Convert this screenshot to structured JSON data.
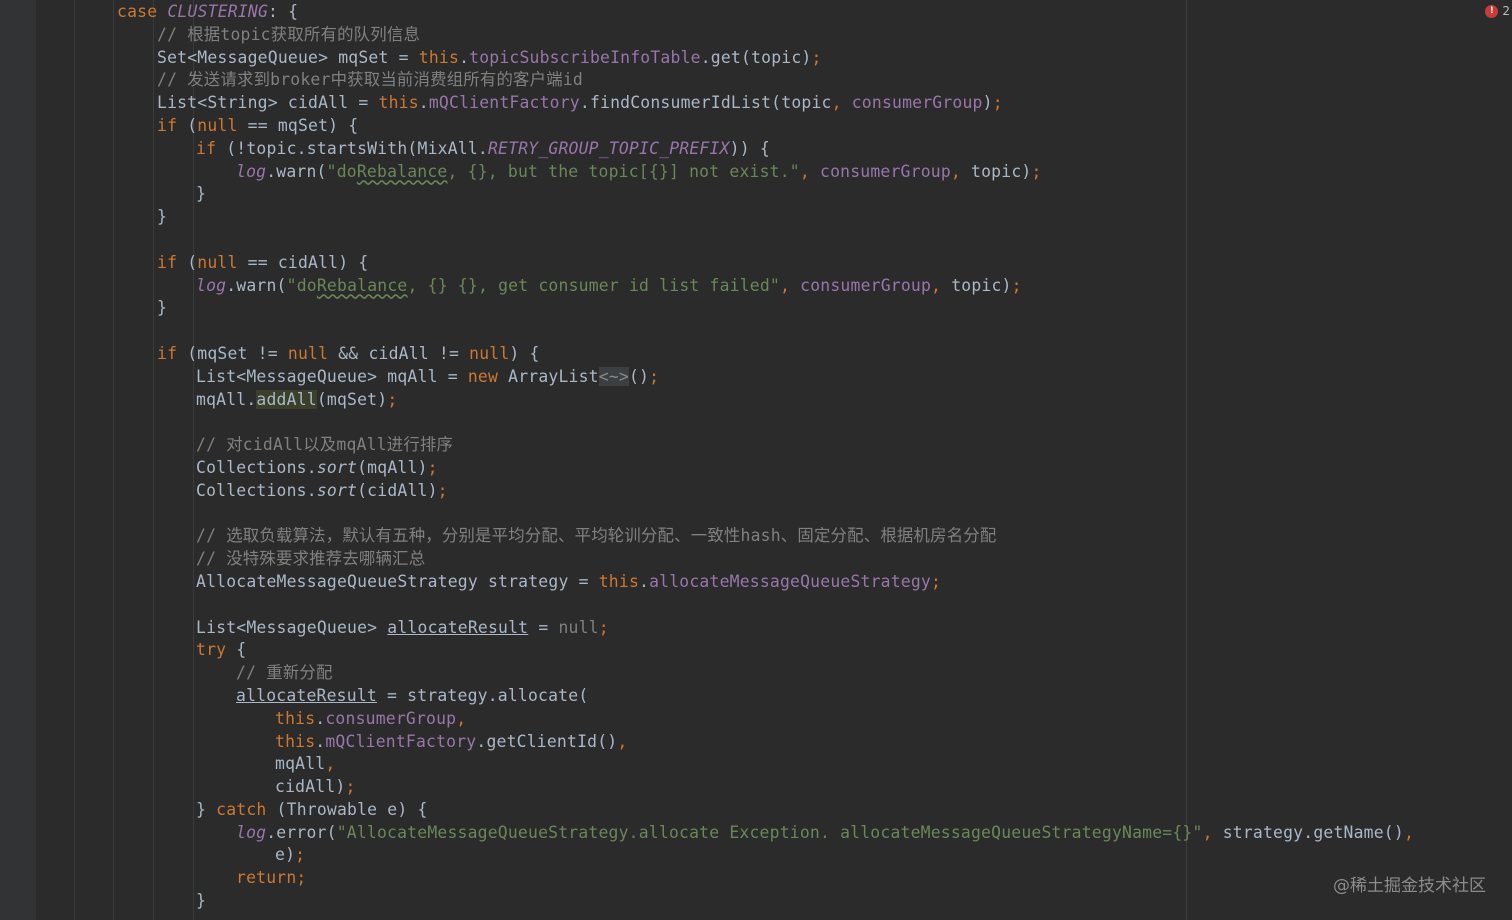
{
  "error_indicator": {
    "count": "2"
  },
  "watermark": "@稀土掘金技术社区",
  "code": {
    "l1": {
      "kw": "case",
      "const": "CLUSTERING",
      "rest": ": {"
    },
    "l2": {
      "comment": "// 根据topic获取所有的队列信息"
    },
    "l3": {
      "a": "Set<MessageQueue> mqSet = ",
      "this": "this",
      "dot": ".",
      "field": "topicSubscribeInfoTable",
      "b": ".get(topic)",
      "semi": ";"
    },
    "l4": {
      "comment": "// 发送请求到broker中获取当前消费组所有的客户端id"
    },
    "l5": {
      "a": "List<String> cidAll = ",
      "this": "this",
      "dot": ".",
      "field": "mQClientFactory",
      "b": ".findConsumerIdList(topic",
      "comma": ", ",
      "field2": "consumerGroup",
      "c": ")",
      "semi": ";"
    },
    "l6": {
      "kw": "if",
      "a": " (",
      "null": "null",
      "b": " == mqSet) {"
    },
    "l7": {
      "kw": "if",
      "a": " (!topic.startsWith(MixAll.",
      "const": "RETRY_GROUP_TOPIC_PREFIX",
      "b": ")) {"
    },
    "l8": {
      "log": "log",
      "a": ".warn(",
      "s1": "\"do",
      "s2": "Rebalance",
      "s3": ", {}, but the topic[{}] not exist.\"",
      "comma": ", ",
      "field": "consumerGroup",
      "comma2": ", ",
      "b": "topic)",
      "semi": ";"
    },
    "l9": {
      "a": "}"
    },
    "l10": {
      "a": "}"
    },
    "l11": {
      "a": ""
    },
    "l12": {
      "kw": "if",
      "a": " (",
      "null": "null",
      "b": " == cidAll) {"
    },
    "l13": {
      "log": "log",
      "a": ".warn(",
      "s1": "\"do",
      "s2": "Rebalance",
      "s3": ", {} {}, get consumer id list failed\"",
      "comma": ", ",
      "field": "consumerGroup",
      "comma2": ", ",
      "b": "topic)",
      "semi": ";"
    },
    "l14": {
      "a": "}"
    },
    "l15": {
      "a": ""
    },
    "l16": {
      "kw": "if",
      "a": " (mqSet != ",
      "null": "null",
      "b": " && cidAll != ",
      "null2": "null",
      "c": ") {"
    },
    "l17": {
      "a": "List<MessageQueue> mqAll = ",
      "kw": "new",
      "b": " ArrayList",
      "diamond": "<~>",
      "c": "()",
      "semi": ";"
    },
    "l18": {
      "a": "mqAll.",
      "hl": "addAll",
      "b": "(mqSet)",
      "semi": ";"
    },
    "l19": {
      "a": ""
    },
    "l20": {
      "comment": "// 对cidAll以及mqAll进行排序"
    },
    "l21": {
      "a": "Collections.",
      "m": "sort",
      "b": "(mqAll)",
      "semi": ";"
    },
    "l22": {
      "a": "Collections.",
      "m": "sort",
      "b": "(cidAll)",
      "semi": ";"
    },
    "l23": {
      "a": ""
    },
    "l24": {
      "comment": "// 选取负载算法，默认有五种，分别是平均分配、平均轮训分配、一致性hash、固定分配、根据机房名分配"
    },
    "l25": {
      "comment": "// 没特殊要求推荐去哪辆汇总"
    },
    "l26": {
      "a": "AllocateMessageQueueStrategy strategy = ",
      "this": "this",
      "dot": ".",
      "field": "allocateMessageQueueStrategy",
      "semi": ";"
    },
    "l27": {
      "a": ""
    },
    "l28": {
      "a": "List<MessageQueue> ",
      "var": "allocateResult",
      "b": " = ",
      "null": "null",
      "semi": ";"
    },
    "l29": {
      "kw": "try",
      "a": " {"
    },
    "l30": {
      "comment": "// 重新分配"
    },
    "l31": {
      "var": "allocateResult",
      "a": " = strategy.allocate("
    },
    "l32": {
      "this": "this",
      "dot": ".",
      "field": "consumerGroup",
      "comma": ","
    },
    "l33": {
      "this": "this",
      "dot": ".",
      "field": "mQClientFactory",
      "a": ".getClientId()",
      "comma": ","
    },
    "l34": {
      "a": "mqAll",
      "comma": ","
    },
    "l35": {
      "a": "cidAll)",
      "semi": ";"
    },
    "l36": {
      "a": "} ",
      "kw": "catch",
      "b": " (Throwable e) {"
    },
    "l37": {
      "log": "log",
      "a": ".error(",
      "s": "\"AllocateMessageQueueStrategy.allocate Exception. allocateMessageQueueStrategyName={}\"",
      "comma": ", ",
      "b": "strategy.getName()",
      "comma2": ","
    },
    "l38": {
      "a": "e)",
      "semi": ";"
    },
    "l39": {
      "kw": "return",
      "semi": ";"
    },
    "l40": {
      "a": "}"
    }
  }
}
